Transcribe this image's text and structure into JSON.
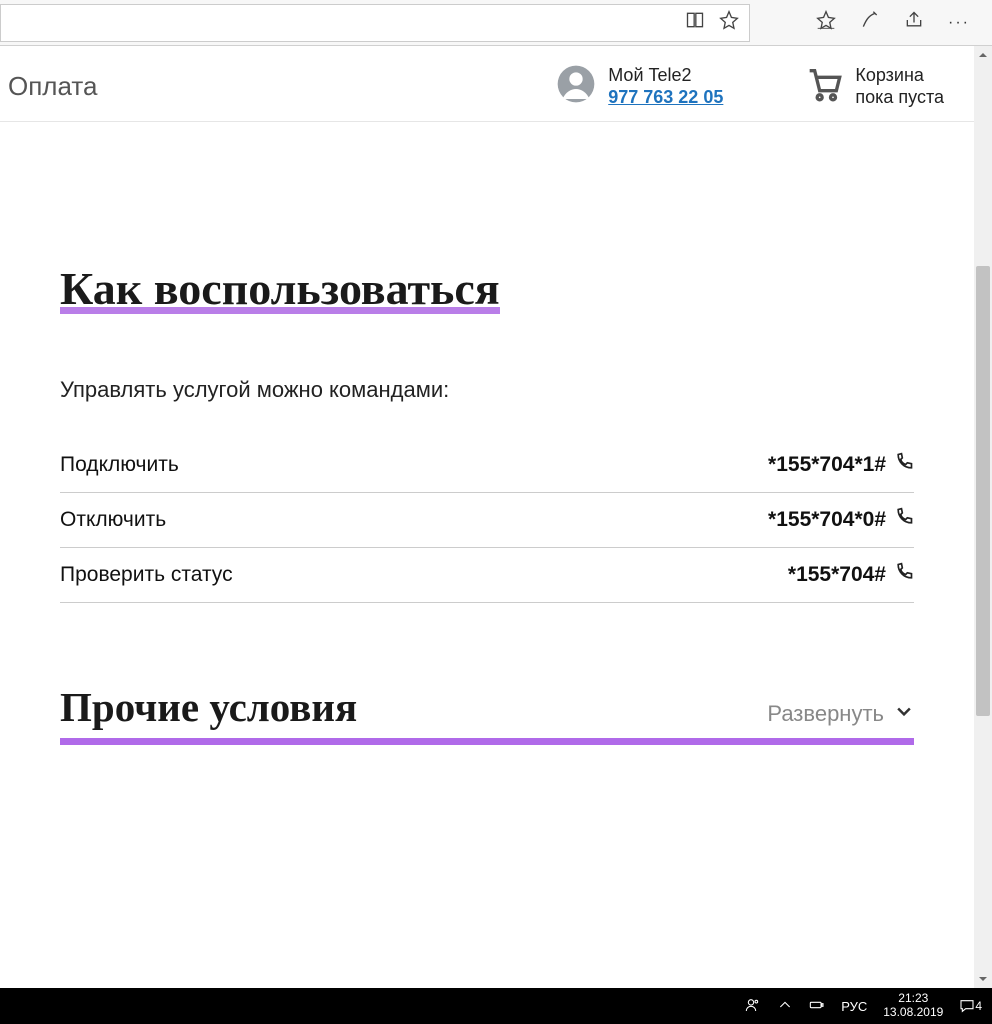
{
  "header": {
    "nav_payment": "Оплата",
    "account_label": "Мой Tele2",
    "account_phone": "977 763 22 05",
    "cart_label": "Корзина",
    "cart_status": "пока пуста"
  },
  "section_howto": {
    "title": "Как воспользоваться",
    "intro": "Управлять услугой можно командами:",
    "commands": [
      {
        "label": "Подключить",
        "code": "*155*704*1#"
      },
      {
        "label": "Отключить",
        "code": "*155*704*0#"
      },
      {
        "label": "Проверить статус",
        "code": "*155*704#"
      }
    ]
  },
  "section_other": {
    "title": "Прочие условия",
    "expand": "Развернуть"
  },
  "taskbar": {
    "lang": "РУС",
    "time": "21:23",
    "date": "13.08.2019",
    "notif_count": "4"
  }
}
